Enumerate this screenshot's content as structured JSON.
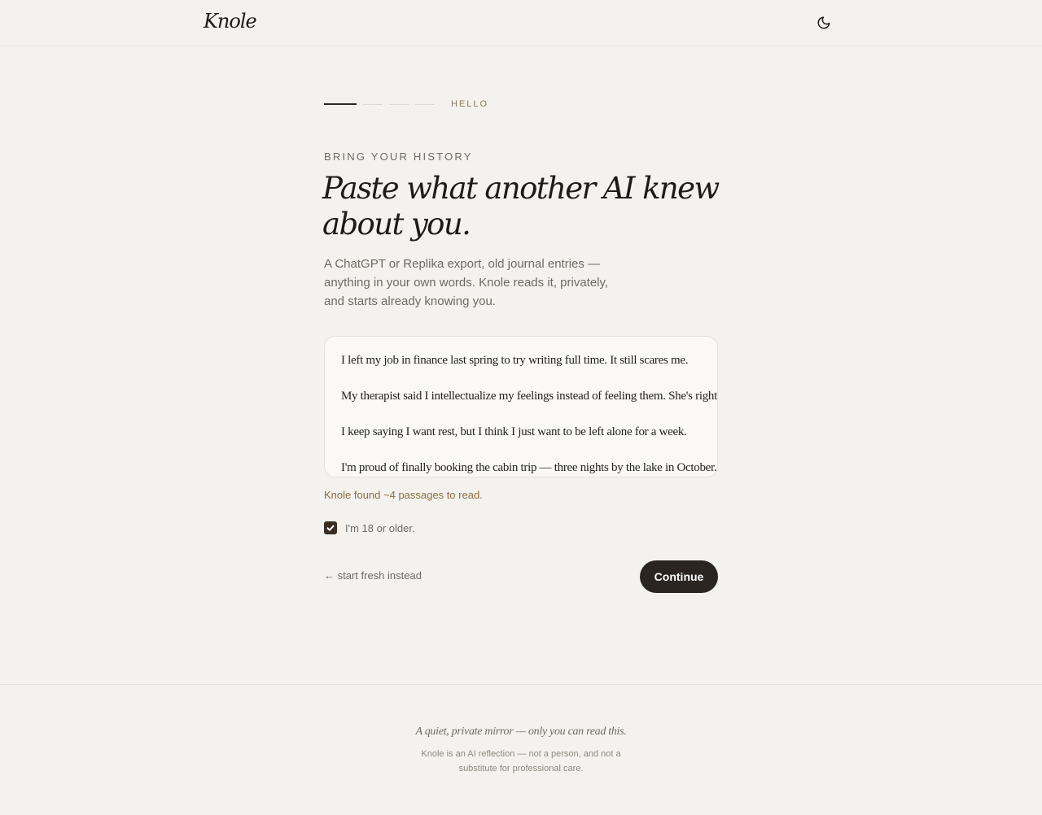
{
  "header": {
    "logo": "Knole",
    "theme_toggle_icon": "moon-icon"
  },
  "progress": {
    "total_steps": 4,
    "current_step": 1,
    "step_label": "HELLO"
  },
  "main": {
    "eyebrow": "BRING YOUR HISTORY",
    "headline": "Paste what another AI knew about you.",
    "lede": "A ChatGPT or Replika export, old journal entries — anything in your own words. Knole reads it, privately, and starts already knowing you.",
    "history_lines": [
      "I left my job in finance last spring to try writing full time. It still scares me.",
      "My therapist said I intellectualize my feelings instead of feeling them. She's right.",
      "I keep saying I want rest, but I think I just want to be left alone for a week.",
      "I'm proud of finally booking the cabin trip — three nights by the lake in October."
    ],
    "found_text": "Knole found ~4 passages to read.",
    "age_checkbox": {
      "label": "I'm 18 or older.",
      "checked": true
    },
    "start_fresh_link": "← start fresh instead",
    "continue_button": "Continue"
  },
  "footer": {
    "tagline": "A quiet, private mirror — only you can read this.",
    "disclaimer": "Knole is an AI reflection — not a person, and not a substitute for professional care."
  },
  "colors": {
    "background": "#f3f2ee",
    "ink": "#1e1b17",
    "muted": "#6e6a63",
    "accent": "#8b6e3f",
    "button": "#2a2521"
  }
}
